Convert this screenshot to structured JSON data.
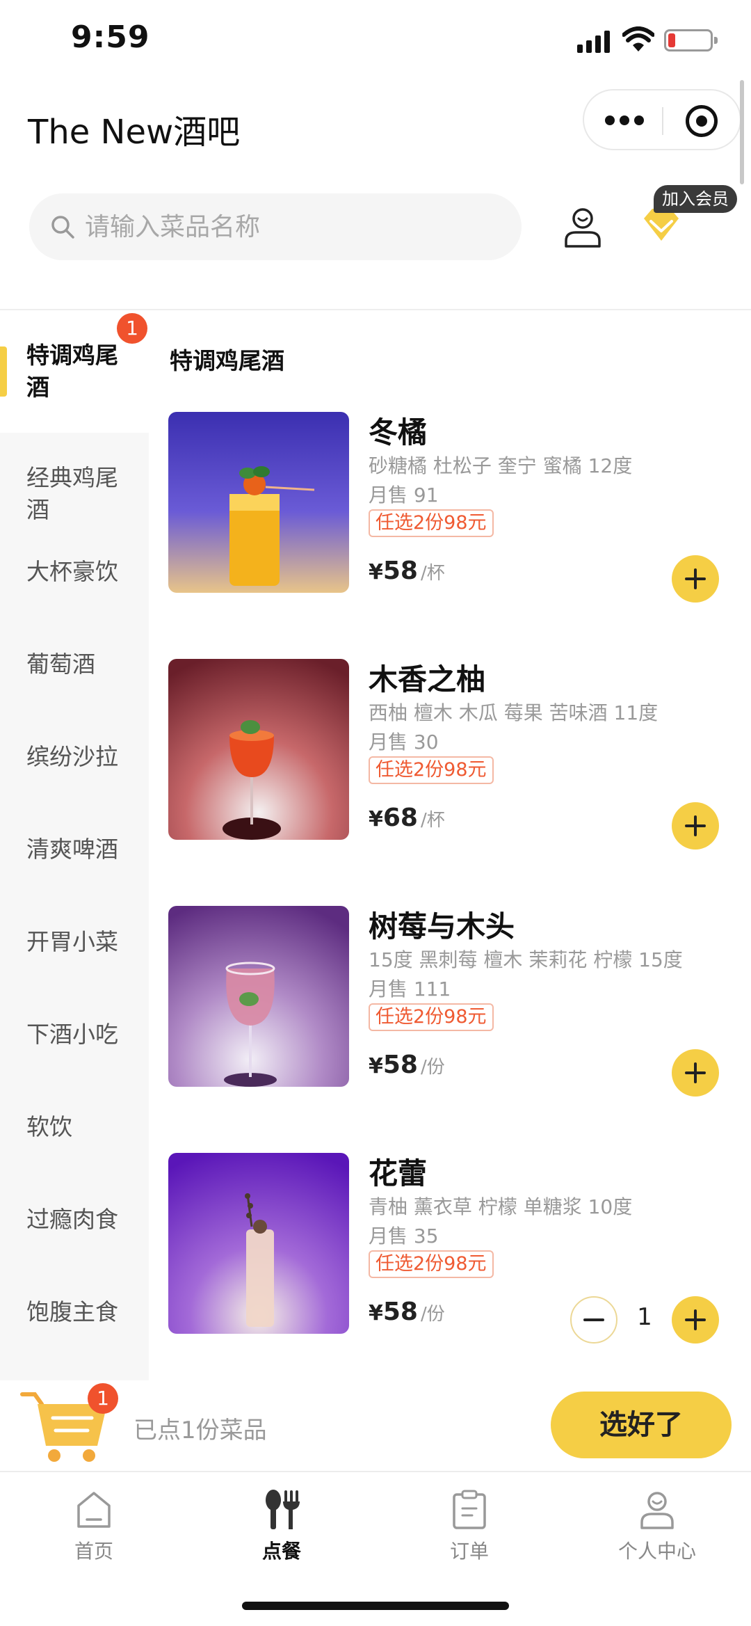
{
  "status_bar": {
    "time": "9:59",
    "battery_level": 0.18
  },
  "header": {
    "title": "The New酒吧"
  },
  "search": {
    "placeholder": "请输入菜品名称"
  },
  "member": {
    "badge_label": "加入会员"
  },
  "sidebar": {
    "items": [
      {
        "label": "特调鸡尾酒",
        "active": true,
        "badge": "1"
      },
      {
        "label": "经典鸡尾酒"
      },
      {
        "label": "大杯豪饮"
      },
      {
        "label": "葡萄酒"
      },
      {
        "label": "缤纷沙拉"
      },
      {
        "label": "清爽啤酒"
      },
      {
        "label": "开胃小菜"
      },
      {
        "label": "下酒小吃"
      },
      {
        "label": "软饮"
      },
      {
        "label": "过瘾肉食"
      },
      {
        "label": "饱腹主食"
      }
    ]
  },
  "main": {
    "section_title": "特调鸡尾酒",
    "products": [
      {
        "name": "冬橘",
        "desc": "砂糖橘 杜松子 奎宁 蜜橘 12度",
        "sales": "月售 91",
        "promo": "任选2份98元",
        "currency": "¥",
        "price": "58",
        "unit": "/杯",
        "quantity": 0
      },
      {
        "name": "木香之柚",
        "desc": "西柚 檀木 木瓜 莓果 苦味酒 11度",
        "sales": "月售 30",
        "promo": "任选2份98元",
        "currency": "¥",
        "price": "68",
        "unit": "/杯",
        "quantity": 0
      },
      {
        "name": "树莓与木头",
        "desc": "15度 黑刺莓 檀木 茉莉花 柠檬 15度",
        "sales": "月售 111",
        "promo": "任选2份98元",
        "currency": "¥",
        "price": "58",
        "unit": "/份",
        "quantity": 0
      },
      {
        "name": "花蕾",
        "desc": "青柚 薰衣草 柠檬 单糖浆 10度",
        "sales": "月售 35",
        "promo": "任选2份98元",
        "currency": "¥",
        "price": "58",
        "unit": "/份",
        "quantity": "1"
      }
    ]
  },
  "cart": {
    "badge": "1",
    "summary": "已点1份菜品",
    "checkout_label": "选好了"
  },
  "tabbar": {
    "items": [
      {
        "label": "首页",
        "icon": "home-icon"
      },
      {
        "label": "点餐",
        "icon": "utensils-icon",
        "active": true
      },
      {
        "label": "订单",
        "icon": "clipboard-icon"
      },
      {
        "label": "个人中心",
        "icon": "user-icon"
      }
    ]
  },
  "colors": {
    "accent": "#f5ce45",
    "badge": "#f0522d",
    "promo": "#ef5a32"
  }
}
